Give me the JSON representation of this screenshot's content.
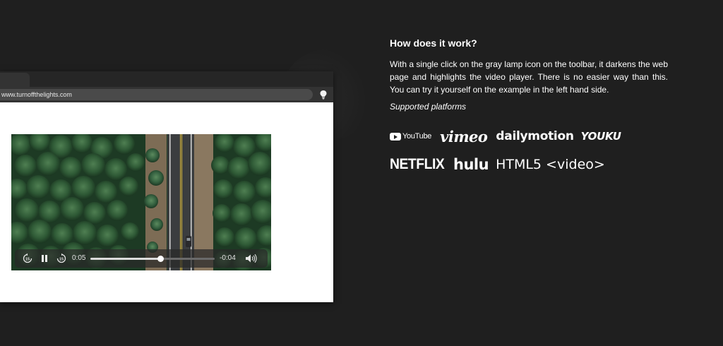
{
  "browser": {
    "url": "www.turnoffthelights.com",
    "toolbar_icon": "lamp-icon"
  },
  "player": {
    "current_time": "0:05",
    "remaining_time": "-0:04",
    "progress": 0.56,
    "controls": [
      "skip-back-15-icon",
      "pause-icon",
      "skip-forward-15-icon",
      "volume-icon"
    ],
    "skip_back_label": "15",
    "skip_forward_label": "15"
  },
  "info": {
    "heading": "How does it work?",
    "description": "With a single click on the gray lamp icon on the toolbar, it darkens the web page and highlights the video player. There is no easier way than this. You can try it yourself on the example in the left hand side.",
    "supported_label": "Supported platforms"
  },
  "platforms": {
    "row1": {
      "youtube": "YouTube",
      "vimeo": "vimeo",
      "dailymotion": "dailymotion",
      "youku": "YOUKU"
    },
    "row2": {
      "netflix": "NETFLIX",
      "hulu": "hulu",
      "html5": "HTML5 <video>"
    }
  },
  "colors": {
    "background": "#1f1f1f",
    "text": "#ffffff",
    "page": "#ffffff"
  }
}
